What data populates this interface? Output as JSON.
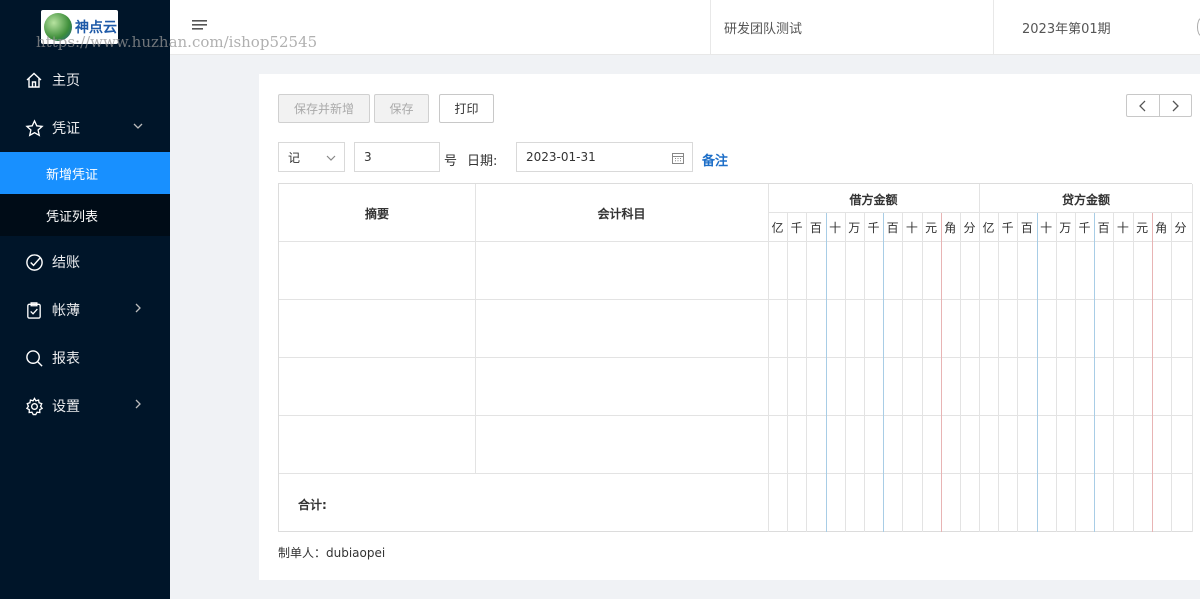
{
  "sidebar": {
    "logo_text": "神点云",
    "items": [
      {
        "label": "主页",
        "icon": "home-icon"
      },
      {
        "label": "凭证",
        "icon": "star-icon",
        "expanded": true,
        "children": [
          {
            "label": "新增凭证",
            "active": true
          },
          {
            "label": "凭证列表",
            "active": false
          }
        ]
      },
      {
        "label": "结账",
        "icon": "check-circle-icon"
      },
      {
        "label": "帐薄",
        "icon": "clipboard-check-icon"
      },
      {
        "label": "报表",
        "icon": "search-icon"
      },
      {
        "label": "设置",
        "icon": "gear-icon"
      }
    ]
  },
  "watermark": "https://www.huzhan.com/ishop52545",
  "header": {
    "team": "研发团队测试",
    "period": "2023年第01期"
  },
  "toolbar": {
    "save_new_label": "保存并新增",
    "save_label": "保存",
    "print_label": "打印"
  },
  "form": {
    "voucher_word": "记",
    "voucher_number": "3",
    "number_suffix": "号",
    "date_label": "日期:",
    "date_value": "2023-01-31",
    "remark_link": "备注"
  },
  "table": {
    "col_summary": "摘要",
    "col_account": "会计科目",
    "col_debit": "借方金额",
    "col_credit": "贷方金额",
    "debit_digits": [
      "亿",
      "千",
      "百",
      "十",
      "万",
      "千",
      "百",
      "十",
      "元",
      "角",
      "分"
    ],
    "credit_digits": [
      "亿",
      "千",
      "百",
      "十",
      "万",
      "千",
      "百",
      "十",
      "元",
      "角",
      "分"
    ],
    "total_label": "合计:"
  },
  "footer": {
    "maker": "制单人：dubiaopei"
  },
  "colors": {
    "sidebar_bg": "#001529",
    "active_item": "#1890ff",
    "link": "#1e6fc8"
  }
}
